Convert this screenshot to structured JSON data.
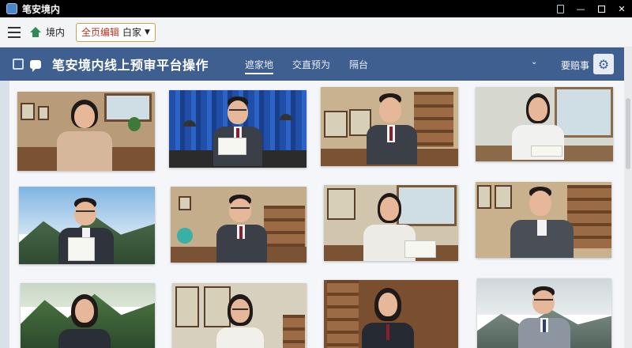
{
  "window": {
    "title": "笔安境内"
  },
  "toolbar": {
    "nav_label": "境内",
    "select_accent": "全页编辑",
    "select_value": "白家"
  },
  "header": {
    "title": "笔安境内线上预审平台操作",
    "tabs": [
      {
        "label": "遮家地",
        "active": true
      },
      {
        "label": "交直预为",
        "active": false
      },
      {
        "label": "隔台",
        "active": false
      }
    ],
    "user": "要赔事"
  },
  "colors": {
    "header_bg": "#3e5f8f",
    "titlebar_bg": "#000000",
    "toolbar_bg": "#f3f4f6",
    "content_bg": "#f4f6f9"
  },
  "icons": {
    "app": "app-icon",
    "menu": "menu-icon",
    "home": "home-icon",
    "header_logo": "logo-icon",
    "chat": "chat-icon",
    "settings": "gear-icon"
  },
  "gallery": {
    "photos": [
      {
        "scene": "study with shelves and window",
        "subject": "woman in beige cardigan"
      },
      {
        "scene": "blue curtain stage with lamps",
        "subject": "man in suit reading document"
      },
      {
        "scene": "office with framed maps",
        "subject": "man in suit writing at desk"
      },
      {
        "scene": "bright office with windows",
        "subject": "woman in white shirt writing"
      },
      {
        "scene": "mountain landscape outdoors",
        "subject": "man in suit holding paper"
      },
      {
        "scene": "study with bookshelves and globe",
        "subject": "man in suit at desk"
      },
      {
        "scene": "office with calligraphy and window",
        "subject": "woman in blazer with paper"
      },
      {
        "scene": "library with map frames",
        "subject": "man in suit with shelves"
      },
      {
        "scene": "forest landscape",
        "subject": "woman in dark suit"
      },
      {
        "scene": "room with framed art",
        "subject": "woman with glasses in white shirt"
      },
      {
        "scene": "wooden office",
        "subject": "woman in dark suit"
      },
      {
        "scene": "coastal landscape",
        "subject": "man with glasses in suit"
      }
    ]
  }
}
